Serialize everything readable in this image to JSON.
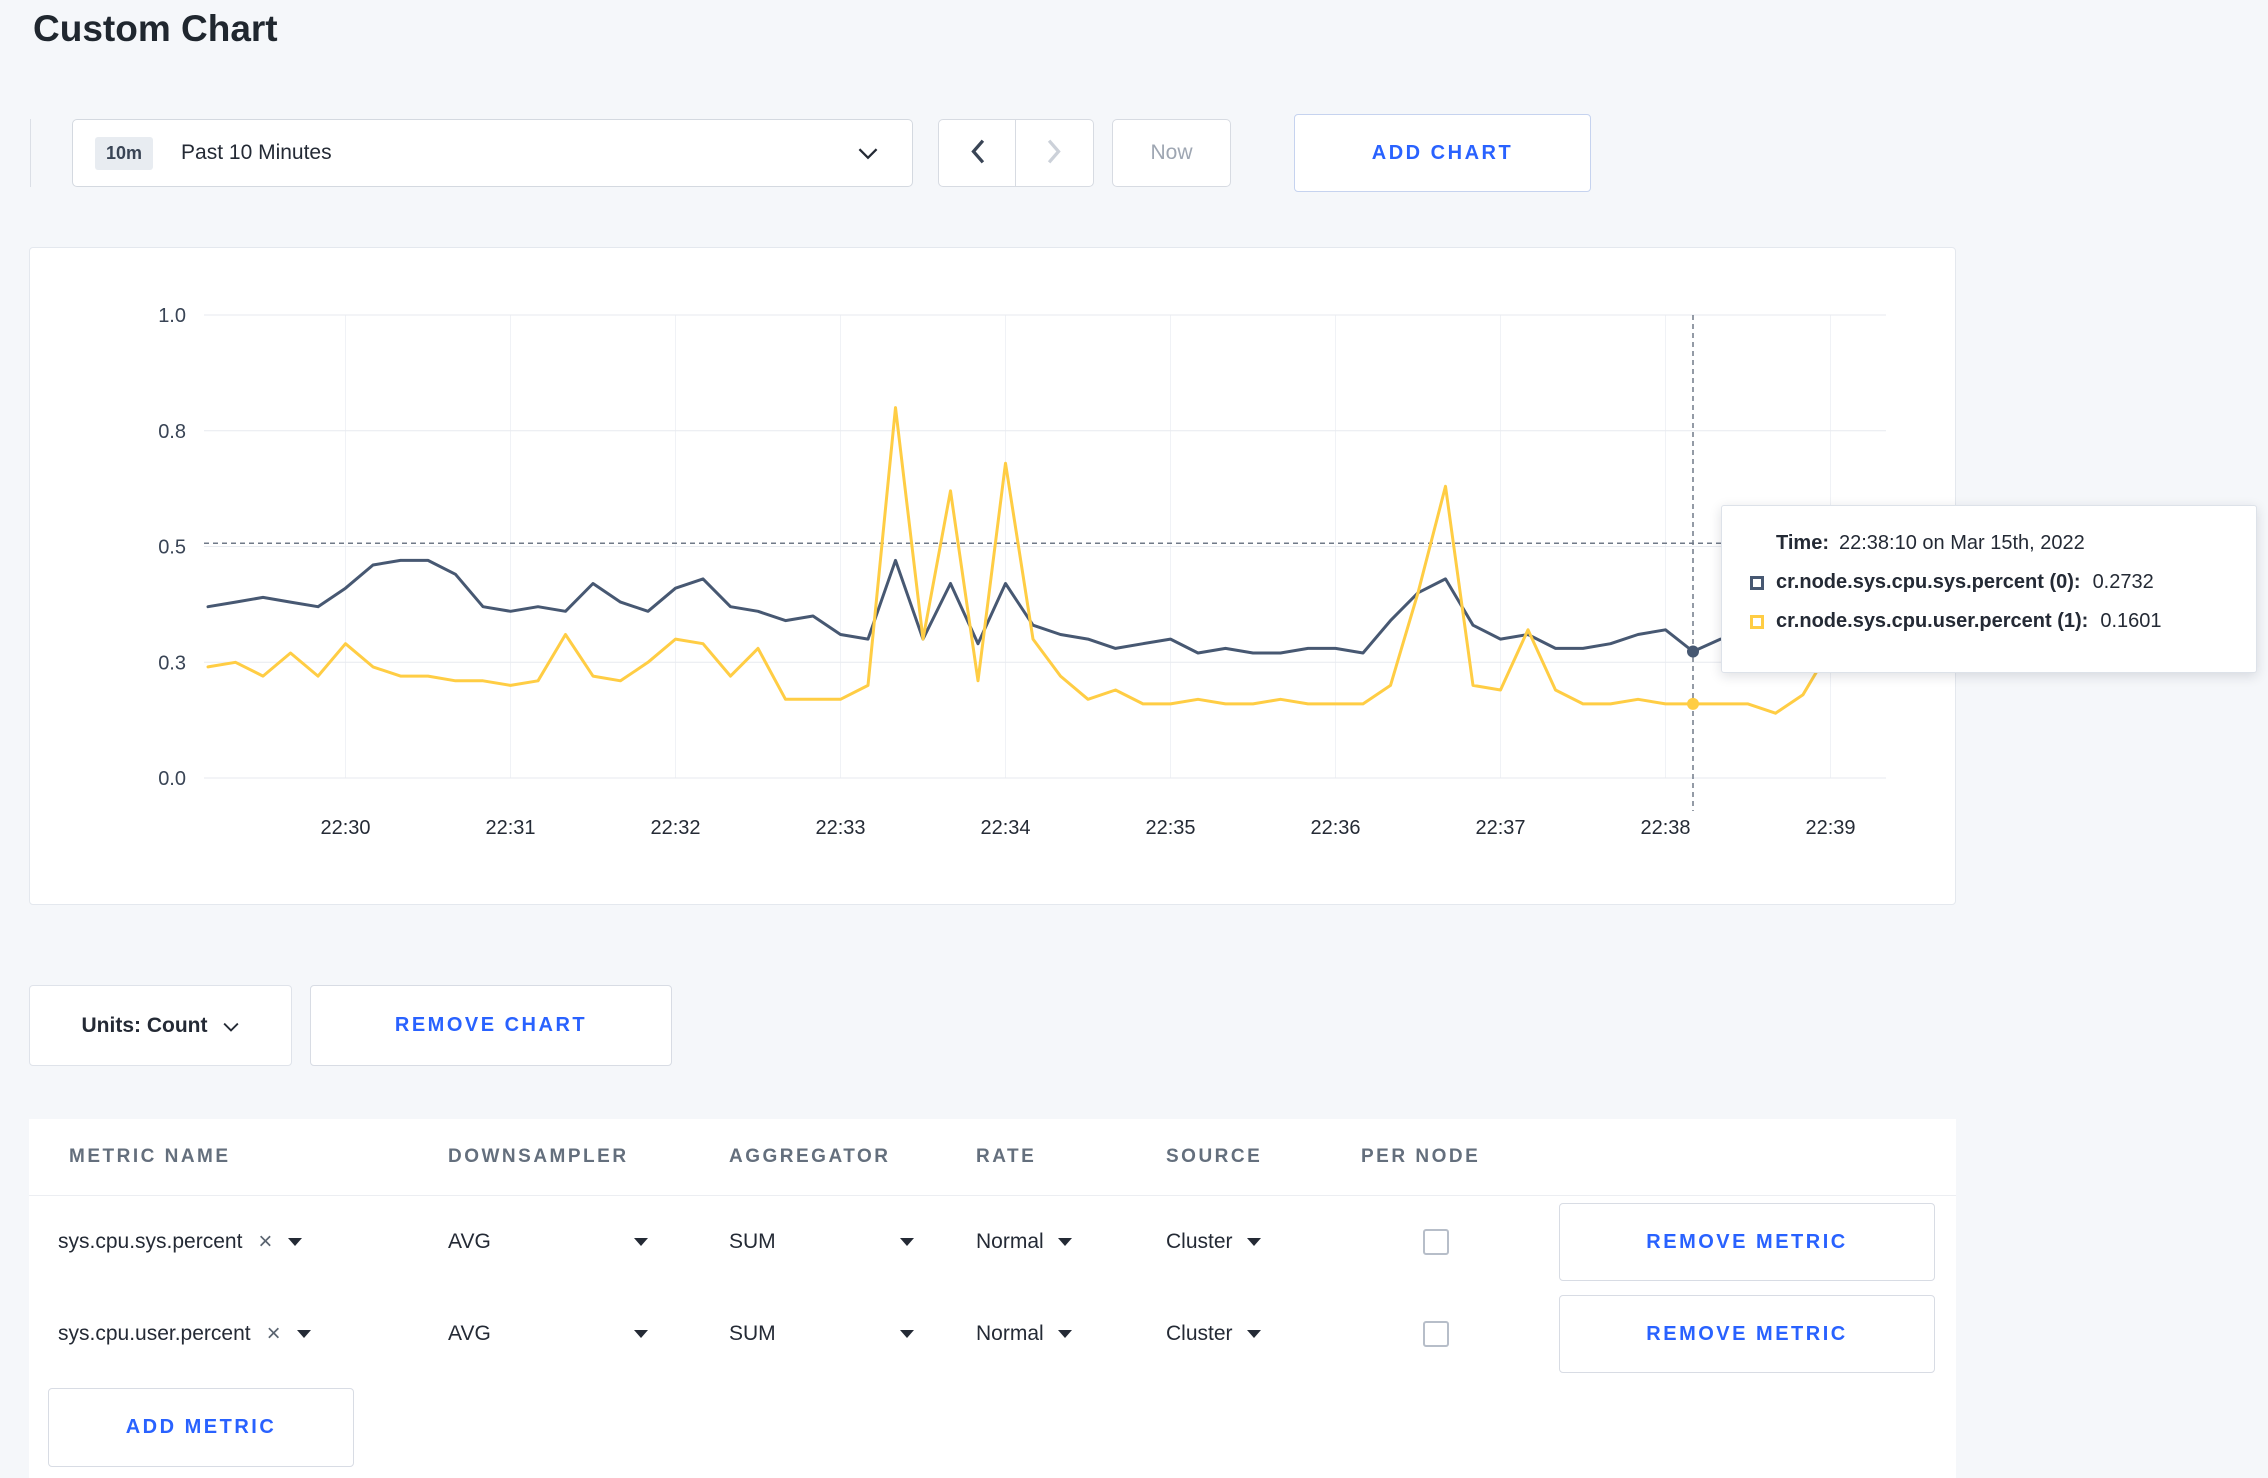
{
  "page": {
    "title": "Custom Chart"
  },
  "colors": {
    "accent_blue": "#2962ff",
    "series_sys": "#475872",
    "series_user": "#ffcd44",
    "page_bg": "#f5f7fa"
  },
  "toolbar": {
    "timerange_badge": "10m",
    "timerange_label": "Past 10 Minutes",
    "now_label": "Now",
    "add_chart_label": "ADD CHART"
  },
  "chart_controls": {
    "units_label": "Units: Count",
    "remove_chart_label": "REMOVE CHART"
  },
  "chart_tooltip": {
    "time_label": "Time:",
    "time_value": "22:38:10 on Mar 15th, 2022",
    "rows": [
      {
        "label": "cr.node.sys.cpu.sys.percent (0):",
        "value": "0.2732"
      },
      {
        "label": "cr.node.sys.cpu.user.percent (1):",
        "value": "0.1601"
      }
    ]
  },
  "chart_data": {
    "type": "line",
    "title": "",
    "x_unit": "time",
    "start_time": "22:29:10",
    "point_interval_seconds": 10,
    "x_tick_labels": [
      "22:30",
      "22:31",
      "22:32",
      "22:33",
      "22:34",
      "22:35",
      "22:36",
      "22:37",
      "22:38",
      "22:39"
    ],
    "x_tick_indices": [
      5,
      11,
      17,
      23,
      29,
      35,
      41,
      47,
      53,
      59
    ],
    "ylim": [
      0,
      1
    ],
    "y_ticks": [
      {
        "label": "0.0",
        "pos": 0
      },
      {
        "label": "0.3",
        "pos": 0.25
      },
      {
        "label": "0.5",
        "pos": 0.5
      },
      {
        "label": "0.8",
        "pos": 0.75
      },
      {
        "label": "1.0",
        "pos": 1.0
      }
    ],
    "grid": true,
    "legend_position": "tooltip",
    "crosshair": {
      "index": 54,
      "time": "22:38:10",
      "h_value": 0.507
    },
    "series": [
      {
        "name": "cr.node.sys.cpu.sys.percent (0)",
        "color": "#475872",
        "values": [
          0.37,
          0.38,
          0.39,
          0.38,
          0.37,
          0.41,
          0.46,
          0.47,
          0.47,
          0.44,
          0.37,
          0.36,
          0.37,
          0.36,
          0.42,
          0.38,
          0.36,
          0.41,
          0.43,
          0.37,
          0.36,
          0.34,
          0.35,
          0.31,
          0.3,
          0.47,
          0.3,
          0.42,
          0.29,
          0.42,
          0.33,
          0.31,
          0.3,
          0.28,
          0.29,
          0.3,
          0.27,
          0.28,
          0.27,
          0.27,
          0.28,
          0.28,
          0.27,
          0.34,
          0.4,
          0.43,
          0.33,
          0.3,
          0.31,
          0.28,
          0.28,
          0.29,
          0.31,
          0.32,
          0.2732,
          0.3,
          0.3,
          0.31,
          0.3,
          0.3,
          0.3
        ]
      },
      {
        "name": "cr.node.sys.cpu.user.percent (1)",
        "color": "#ffcd44",
        "values": [
          0.24,
          0.25,
          0.22,
          0.27,
          0.22,
          0.29,
          0.24,
          0.22,
          0.22,
          0.21,
          0.21,
          0.2,
          0.21,
          0.31,
          0.22,
          0.21,
          0.25,
          0.3,
          0.29,
          0.22,
          0.28,
          0.17,
          0.17,
          0.17,
          0.2,
          0.8,
          0.3,
          0.62,
          0.21,
          0.68,
          0.3,
          0.22,
          0.17,
          0.19,
          0.16,
          0.16,
          0.17,
          0.16,
          0.16,
          0.17,
          0.16,
          0.16,
          0.16,
          0.2,
          0.4,
          0.63,
          0.2,
          0.19,
          0.32,
          0.19,
          0.16,
          0.16,
          0.17,
          0.16,
          0.1601,
          0.16,
          0.16,
          0.14,
          0.18,
          0.28,
          0.24
        ]
      }
    ]
  },
  "metrics_table": {
    "headers": [
      "METRIC NAME",
      "DOWNSAMPLER",
      "AGGREGATOR",
      "RATE",
      "SOURCE",
      "PER NODE"
    ],
    "rows": [
      {
        "metric": "sys.cpu.sys.percent",
        "downsampler": "AVG",
        "aggregator": "SUM",
        "rate": "Normal",
        "source": "Cluster",
        "per_node_checked": false,
        "remove_label": "REMOVE METRIC"
      },
      {
        "metric": "sys.cpu.user.percent",
        "downsampler": "AVG",
        "aggregator": "SUM",
        "rate": "Normal",
        "source": "Cluster",
        "per_node_checked": false,
        "remove_label": "REMOVE METRIC"
      }
    ],
    "add_metric_label": "ADD METRIC"
  }
}
